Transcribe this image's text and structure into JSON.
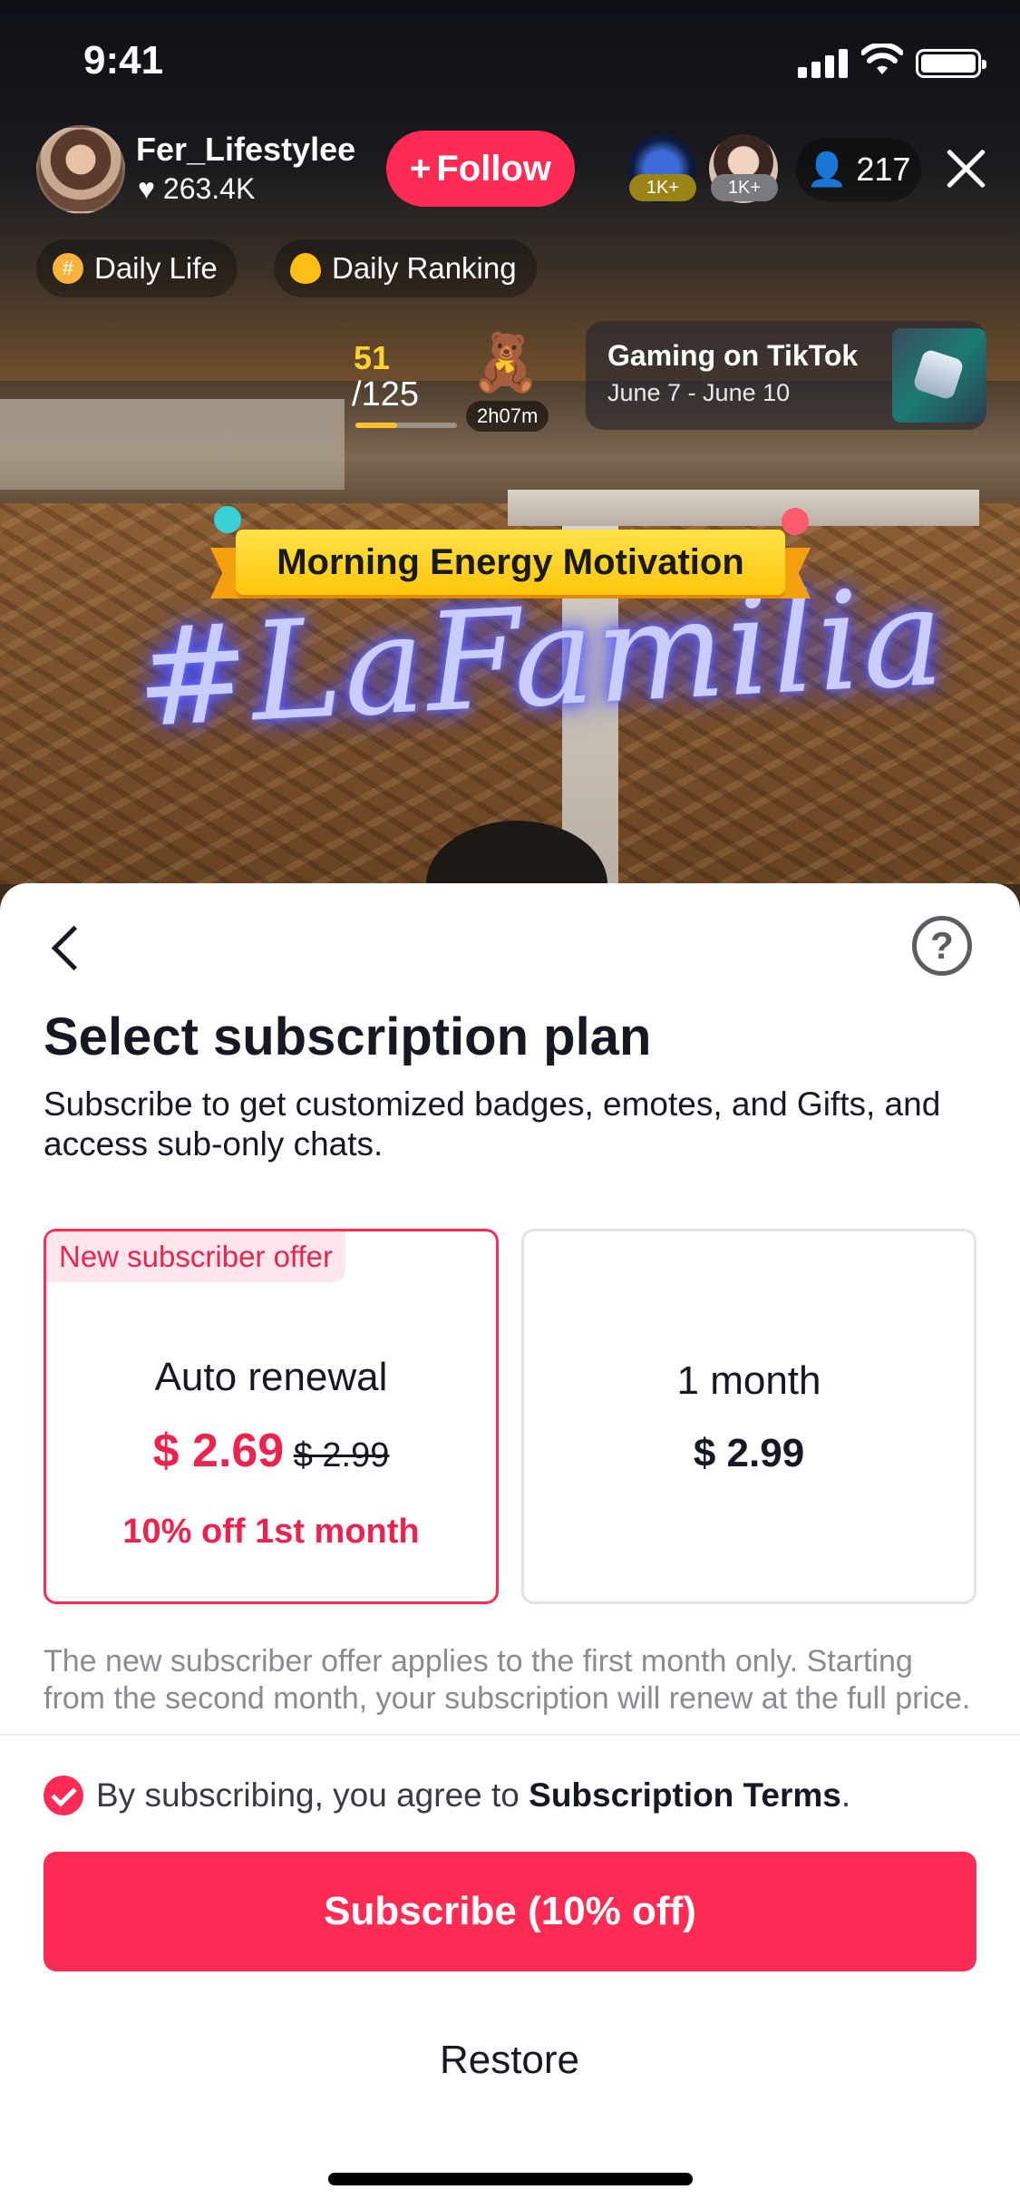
{
  "status_bar": {
    "time": "9:41"
  },
  "live": {
    "host": {
      "name": "Fer_Lifestylee",
      "likes": "263.4K"
    },
    "follow_label": "Follow",
    "viewer_badges": [
      "1K+",
      "1K+"
    ],
    "viewer_count": "217",
    "tags": [
      {
        "label": "Daily Life",
        "icon": "hashtag-icon"
      },
      {
        "label": "Daily Ranking",
        "icon": "flame-icon"
      }
    ],
    "goal": {
      "current": "51",
      "total": "/125",
      "progress": 0.41,
      "timer": "2h07m"
    },
    "event": {
      "title": "Gaming on TikTok",
      "dates": "June 7 - June 10"
    },
    "banner": "Morning Energy Motivation",
    "neon_sign": "#LaFamilia"
  },
  "sheet": {
    "title": "Select subscription plan",
    "description": "Subscribe to get customized badges, emotes, and Gifts, and access sub-only chats.",
    "plans": [
      {
        "offer_tag": "New subscriber offer",
        "name": "Auto renewal",
        "price": "$ 2.69",
        "original_price": "$ 2.99",
        "discount": "10% off 1st month",
        "selected": true
      },
      {
        "name": "1 month",
        "price": "$ 2.99",
        "selected": false
      }
    ],
    "fine_print": "The new subscriber offer applies to the first month only. Starting from the second month, your subscription will renew at the full price."
  },
  "footer": {
    "agree_prefix": "By subscribing, you agree to ",
    "agree_link": "Subscription Terms",
    "agree_suffix": ".",
    "subscribe_label": "Subscribe (10% off)",
    "restore_label": "Restore"
  },
  "colors": {
    "accent": "#fe2c55",
    "offer_bg": "#ffe6ec",
    "text": "#161823"
  }
}
